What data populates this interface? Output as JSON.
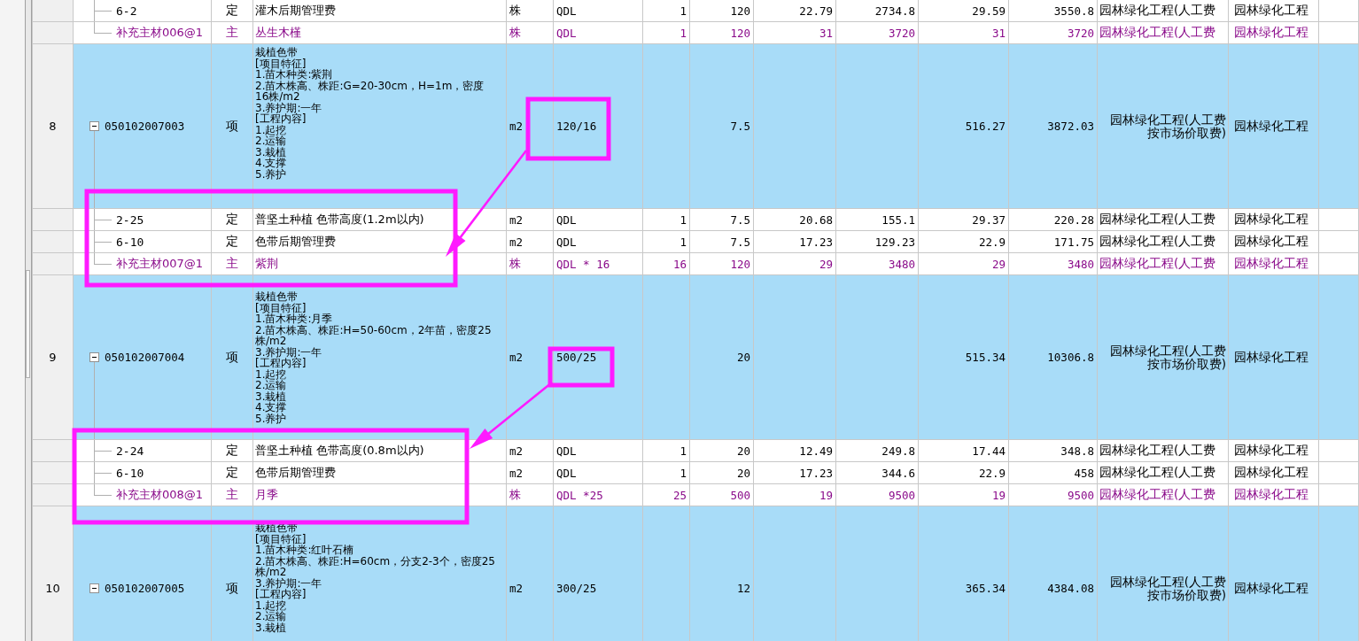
{
  "rows": [
    {
      "kind": "continued",
      "children": [
        {
          "kind": "quota",
          "cells": {
            "column_2": "6-2",
            "column_3": "定",
            "column_4": "灌木后期管理费",
            "column_5": "株",
            "column_6": "QDL",
            "column_7": "1",
            "column_8": "120",
            "column_9": "22.79",
            "column_10": "2734.8",
            "column_11": "29.59",
            "column_12": "3550.8",
            "column_13": "园林绿化工程(人工费",
            "column_14": "园林绿化工程"
          }
        },
        {
          "kind": "material",
          "cells": {
            "column_2": "补充主材006@1",
            "column_3": "主",
            "column_4": "丛生木槿",
            "column_5": "株",
            "column_6": "QDL",
            "column_7": "1",
            "column_8": "120",
            "column_9": "31",
            "column_10": "3720",
            "column_11": "31",
            "column_12": "3720",
            "column_13": "园林绿化工程(人工费",
            "column_14": "园林绿化工程"
          }
        }
      ]
    },
    {
      "kind": "item",
      "expanded": true,
      "cells": {
        "column_1": "8",
        "column_2": "050102007003",
        "column_3": "项",
        "column_4": "栽植色带\n[项目特征]\n1.苗木种类:紫荆\n2.苗木株高、株距:G=20-30cm，H=1m，密度16株/m2\n3.养护期:一年\n[工程内容]\n1.起挖\n2.运输\n3.栽植\n4.支撑\n5.养护",
        "column_5": "m2",
        "column_6": "120/16",
        "column_8": "7.5",
        "column_11": "516.27",
        "column_12": "3872.03",
        "column_13": "园林绿化工程(人工费按市场价取费)",
        "column_14": "园林绿化工程"
      },
      "children": [
        {
          "kind": "quota",
          "cells": {
            "column_2": "2-25",
            "column_3": "定",
            "column_4": "普坚土种植 色带高度(1.2m以内)",
            "column_5": "m2",
            "column_6": "QDL",
            "column_7": "1",
            "column_8": "7.5",
            "column_9": "20.68",
            "column_10": "155.1",
            "column_11": "29.37",
            "column_12": "220.28",
            "column_13": "园林绿化工程(人工费",
            "column_14": "园林绿化工程"
          }
        },
        {
          "kind": "quota",
          "cells": {
            "column_2": "6-10",
            "column_3": "定",
            "column_4": "色带后期管理费",
            "column_5": "m2",
            "column_6": "QDL",
            "column_7": "1",
            "column_8": "7.5",
            "column_9": "17.23",
            "column_10": "129.23",
            "column_11": "22.9",
            "column_12": "171.75",
            "column_13": "园林绿化工程(人工费",
            "column_14": "园林绿化工程"
          }
        },
        {
          "kind": "material",
          "cells": {
            "column_2": "补充主材007@1",
            "column_3": "主",
            "column_4": "紫荆",
            "column_5": "株",
            "column_6": "QDL * 16",
            "column_7": "16",
            "column_8": "120",
            "column_9": "29",
            "column_10": "3480",
            "column_11": "29",
            "column_12": "3480",
            "column_13": "园林绿化工程(人工费",
            "column_14": "园林绿化工程"
          }
        }
      ]
    },
    {
      "kind": "item",
      "expanded": true,
      "cells": {
        "column_1": "9",
        "column_2": "050102007004",
        "column_3": "项",
        "column_4": "栽植色带\n[项目特征]\n1.苗木种类:月季\n2.苗木株高、株距:H=50-60cm，2年苗，密度25株/m2\n3.养护期:一年\n[工程内容]\n1.起挖\n2.运输\n3.栽植\n4.支撑\n5.养护",
        "column_5": "m2",
        "column_6": "500/25",
        "column_8": "20",
        "column_11": "515.34",
        "column_12": "10306.8",
        "column_13": "园林绿化工程(人工费按市场价取费)",
        "column_14": "园林绿化工程"
      },
      "children": [
        {
          "kind": "quota",
          "cells": {
            "column_2": "2-24",
            "column_3": "定",
            "column_4": "普坚土种植 色带高度(0.8m以内)",
            "column_5": "m2",
            "column_6": "QDL",
            "column_7": "1",
            "column_8": "20",
            "column_9": "12.49",
            "column_10": "249.8",
            "column_11": "17.44",
            "column_12": "348.8",
            "column_13": "园林绿化工程(人工费",
            "column_14": "园林绿化工程"
          }
        },
        {
          "kind": "quota",
          "cells": {
            "column_2": "6-10",
            "column_3": "定",
            "column_4": "色带后期管理费",
            "column_5": "m2",
            "column_6": "QDL",
            "column_7": "1",
            "column_8": "20",
            "column_9": "17.23",
            "column_10": "344.6",
            "column_11": "22.9",
            "column_12": "458",
            "column_13": "园林绿化工程(人工费",
            "column_14": "园林绿化工程"
          }
        },
        {
          "kind": "material",
          "cells": {
            "column_2": "补充主材008@1",
            "column_3": "主",
            "column_4": "月季",
            "column_5": "株",
            "column_6": "QDL *25",
            "column_7": "25",
            "column_8": "500",
            "column_9": "19",
            "column_10": "9500",
            "column_11": "19",
            "column_12": "9500",
            "column_13": "园林绿化工程(人工费",
            "column_14": "园林绿化工程"
          }
        }
      ]
    },
    {
      "kind": "item",
      "expanded": true,
      "cells": {
        "column_1": "10",
        "column_2": "050102007005",
        "column_3": "项",
        "column_4": "栽植色带\n[项目特征]\n1.苗木种类:红叶石楠\n2.苗木株高、株距:H=60cm，分支2-3个，密度25株/m2\n3.养护期:一年\n[工程内容]\n1.起挖\n2.运输\n3.栽植",
        "column_5": "m2",
        "column_6": "300/25",
        "column_8": "12",
        "column_11": "365.34",
        "column_12": "4384.08",
        "column_13": "园林绿化工程(人工费按市场价取费)",
        "column_14": "园林绿化工程"
      },
      "children": []
    }
  ]
}
